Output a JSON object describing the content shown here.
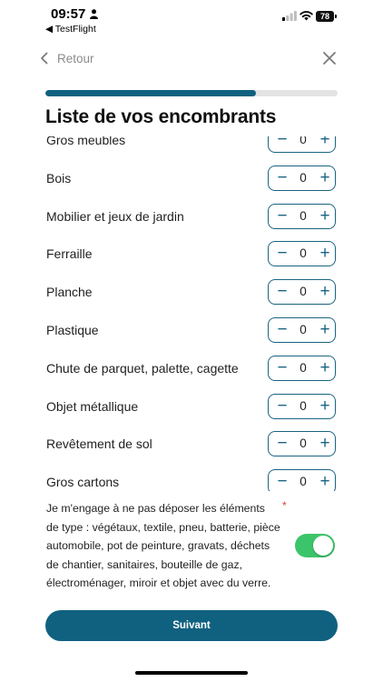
{
  "status_bar": {
    "time": "09:57",
    "back_app_label": "◀ TestFlight",
    "battery_level": "78",
    "icons": [
      "person-icon",
      "signal-icon",
      "wifi-icon",
      "battery-icon"
    ]
  },
  "nav": {
    "back_label": "Retour",
    "back_icon": "chevron-left-icon",
    "close_icon": "close-icon"
  },
  "progress": {
    "fraction": 0.72,
    "fill_color": "#10617f",
    "track_color": "#e3e3e3"
  },
  "page_title": "Liste de vos encombrants",
  "items": [
    {
      "label": "Gros meubles",
      "value": "0"
    },
    {
      "label": "Bois",
      "value": "0"
    },
    {
      "label": "Mobilier et jeux de jardin",
      "value": "0"
    },
    {
      "label": "Ferraille",
      "value": "0"
    },
    {
      "label": "Planche",
      "value": "0"
    },
    {
      "label": "Plastique",
      "value": "0"
    },
    {
      "label": "Chute de parquet, palette, cagette",
      "value": "0"
    },
    {
      "label": "Objet métallique",
      "value": "0"
    },
    {
      "label": "Revêtement de sol",
      "value": "0"
    },
    {
      "label": "Gros cartons",
      "value": "0"
    }
  ],
  "stepper": {
    "minus": "−",
    "plus": "+"
  },
  "consent": {
    "text": "Je m'engage à ne pas déposer les éléments de type : végétaux, textile, pneu, batterie, pièce automobile, pot de peinture, gravats, déchets de chantier, sanitaires, bouteille de gaz, électroménager, miroir et objet avec du verre.",
    "required_mark": "*",
    "toggle_on": true
  },
  "next_button_label": "Suivant",
  "colors": {
    "primary": "#10617f",
    "toggle_on": "#3cc46a",
    "required": "#e0403c"
  }
}
